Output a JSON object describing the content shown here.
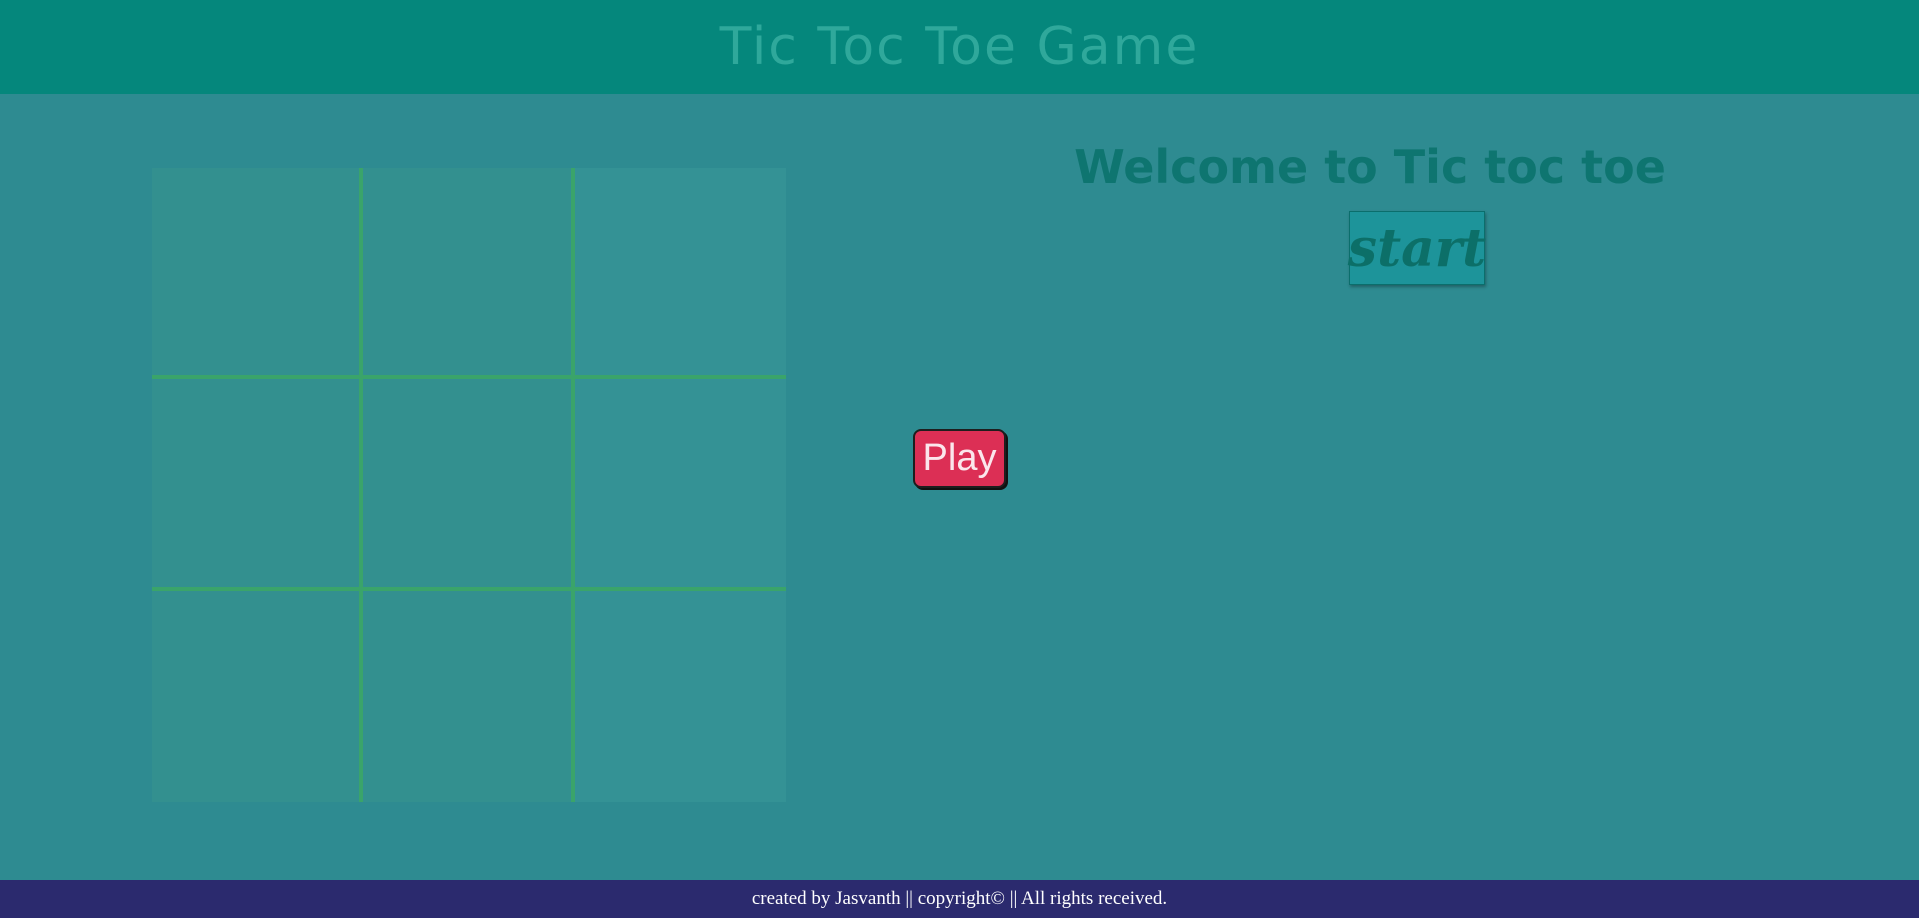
{
  "header": {
    "title": "Tic Toc Toe Game"
  },
  "board": {
    "cells": [
      "",
      "",
      "",
      "",
      "",
      "",
      "",
      "",
      ""
    ]
  },
  "play_button": {
    "label": "Play"
  },
  "panel": {
    "welcome": "Welcome to Tic toc toe",
    "start_label": "start"
  },
  "footer": {
    "text": "created by Jasvanth || copyright© || All rights received."
  },
  "colors": {
    "header_bg": "#05877c",
    "page_bg": "#2e8b91",
    "grid_line": "#3aa46a",
    "play_button": "#dc2f55",
    "footer_bg": "#2b2a6e"
  }
}
